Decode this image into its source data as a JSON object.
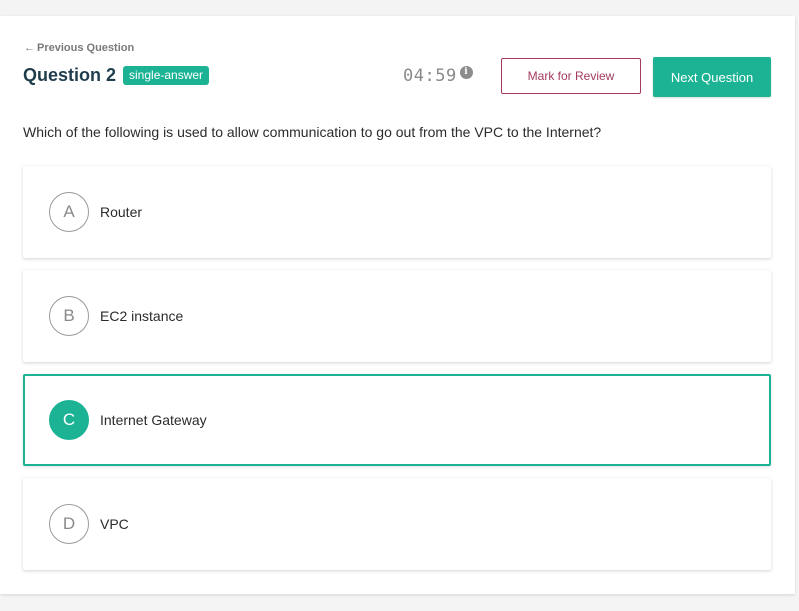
{
  "nav": {
    "prev_label": "Previous Question",
    "prev_icon": "arrow-left-icon"
  },
  "question": {
    "title": "Question 2",
    "badge": "single-answer",
    "text": "Which of the following is used to allow communication to go out from the VPC to the Internet?"
  },
  "timer": {
    "value": "04:59",
    "info_icon": "info-icon"
  },
  "buttons": {
    "review": "Mark for Review",
    "next": "Next Question"
  },
  "options": [
    {
      "letter": "A",
      "text": "Router",
      "selected": false
    },
    {
      "letter": "B",
      "text": "EC2 instance",
      "selected": false
    },
    {
      "letter": "C",
      "text": "Internet Gateway",
      "selected": true
    },
    {
      "letter": "D",
      "text": "VPC",
      "selected": false
    }
  ],
  "colors": {
    "accent": "#1bb394",
    "review": "#a3395e",
    "title": "#1f3d4c"
  }
}
